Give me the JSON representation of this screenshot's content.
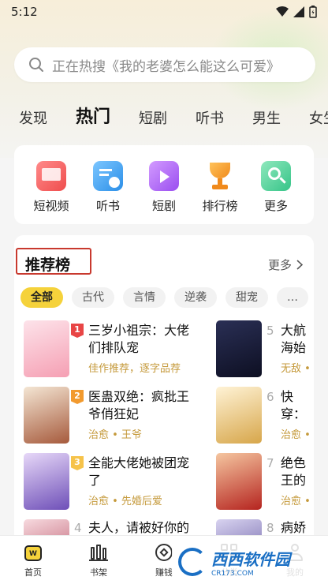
{
  "status": {
    "time": "5:12"
  },
  "search": {
    "placeholder": "正在热搜《我的老婆怎么能这么可爱》"
  },
  "tabs": [
    "发现",
    "热门",
    "短剧",
    "听书",
    "男生",
    "女生"
  ],
  "quick": [
    {
      "label": "短视频",
      "icon": "short-video-icon",
      "color": "#ef5b5b"
    },
    {
      "label": "听书",
      "icon": "audiobook-icon",
      "color": "#3aa4ef"
    },
    {
      "label": "短剧",
      "icon": "short-drama-icon",
      "color": "#a865f0"
    },
    {
      "label": "排行榜",
      "icon": "trophy-icon",
      "color": "#f39a2a"
    },
    {
      "label": "更多",
      "icon": "more-search-icon",
      "color": "#3cc98c"
    }
  ],
  "rank": {
    "title": "推荐榜",
    "more": "更多",
    "chips": [
      "全部",
      "古代",
      "言情",
      "逆袭",
      "甜宠",
      "…"
    ],
    "books": [
      {
        "rank": "1",
        "title": "三岁小祖宗：大佬们排队宠",
        "tags": "佳作推荐，逐字品荐"
      },
      {
        "rank": "2",
        "title": "医蛊双绝：疯批王爷俏狂妃",
        "tags": "治愈 • 王爷"
      },
      {
        "rank": "3",
        "title": "全能大佬她被团宠了",
        "tags": "治愈 • 先婚后爱"
      },
      {
        "rank": "4",
        "title": "夫人，请被好你的",
        "tags": ""
      },
      {
        "rank": "5",
        "title": "大航海始进化",
        "tags": "无敌 •"
      },
      {
        "rank": "6",
        "title": "快穿：常",
        "tags": "治愈 •"
      },
      {
        "rank": "7",
        "title": "绝色王的心",
        "tags": "治愈 •"
      },
      {
        "rank": "8",
        "title": "病娇",
        "tags": ""
      }
    ]
  },
  "nav": [
    {
      "label": "首页",
      "icon": "home-icon"
    },
    {
      "label": "书架",
      "icon": "bookshelf-icon"
    },
    {
      "label": "赚钱",
      "icon": "earn-icon"
    },
    {
      "label": "分类",
      "icon": "category-icon"
    },
    {
      "label": "我的",
      "icon": "profile-icon"
    }
  ],
  "watermark": {
    "name": "西西软件园",
    "site": "CR173.COM"
  }
}
